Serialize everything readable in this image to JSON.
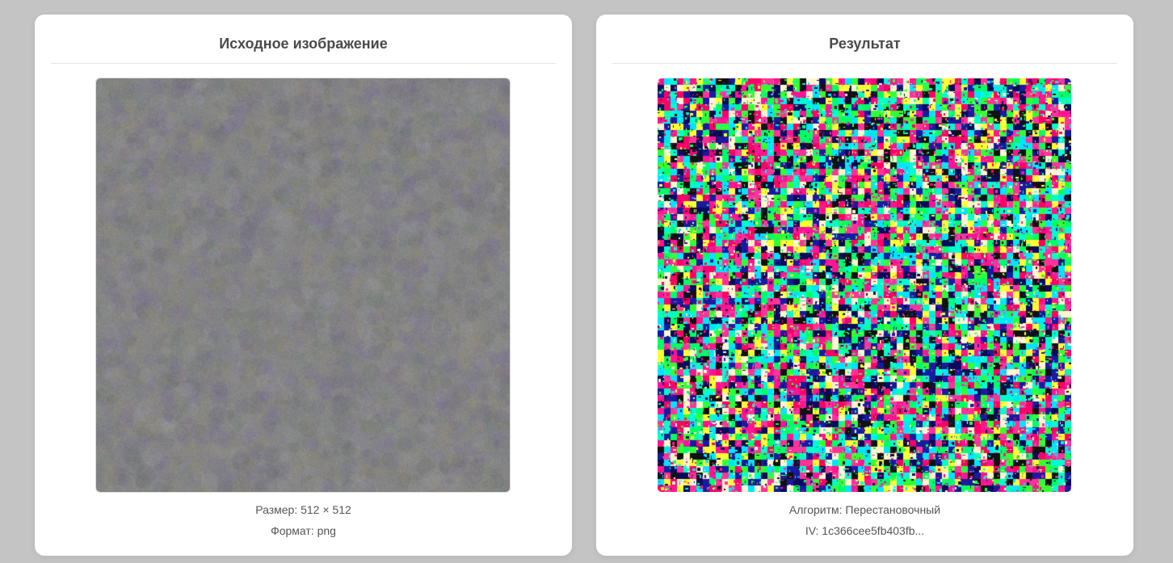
{
  "source_panel": {
    "title": "Исходное изображение",
    "size_line": "Размер: 512 × 512",
    "format_line": "Формат: png",
    "image_description": "gray noise texture"
  },
  "result_panel": {
    "title": "Результат",
    "algorithm_line": "Алгоритм: Перестановочный",
    "iv_line": "IV: 1c366cee5fb403fb..."
  },
  "colors": {
    "background": "#c4c4c4",
    "card": "#ffffff",
    "title_text": "#4a4a4a",
    "info_text": "#555555",
    "source_base_gray": "#858585",
    "result_palette": [
      "#ff1493",
      "#ff0066",
      "#00ff66",
      "#00ffcc",
      "#1a1aa0",
      "#0a0a5a",
      "#ffff33",
      "#fff5d0",
      "#33ff33",
      "#ff3399",
      "#111111",
      "#00e5ff"
    ]
  }
}
